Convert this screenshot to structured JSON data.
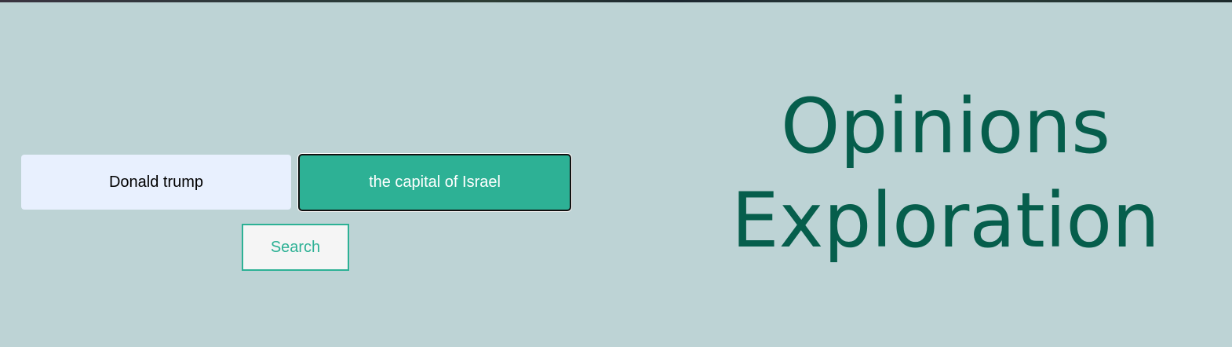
{
  "search": {
    "subject_value": "Donald trump",
    "topic_value": "the capital of Israel",
    "button_label": "Search"
  },
  "header": {
    "title_line_1": "Opinions",
    "title_line_2": "Exploration"
  },
  "colors": {
    "background": "#bdd3d5",
    "accent": "#2db195",
    "title": "#065e4c",
    "subject_field": "#e8f0fe",
    "button_bg": "#f5f5f5"
  }
}
